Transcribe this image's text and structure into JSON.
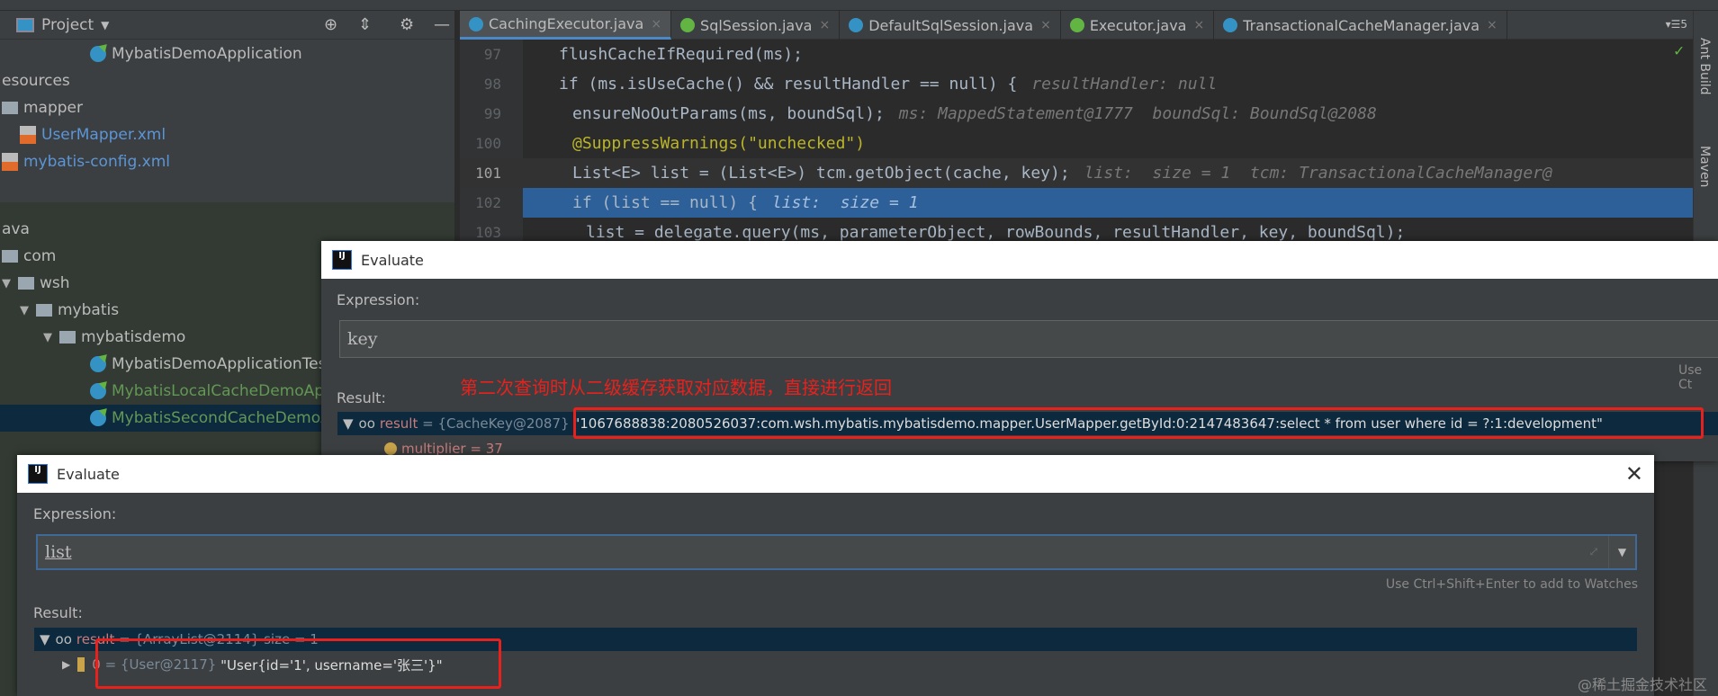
{
  "project_panel": {
    "title": "Project",
    "tree": [
      {
        "label": "MybatisDemoApplication",
        "icon": "spring-class-icon"
      },
      {
        "label": "esources",
        "icon": ""
      },
      {
        "label": "mapper",
        "icon": "folder-icon"
      },
      {
        "label": "UserMapper.xml",
        "icon": "xml-file-icon"
      },
      {
        "label": "mybatis-config.xml",
        "icon": "xml-file-icon"
      },
      {
        "label": "ava",
        "icon": ""
      },
      {
        "label": "com",
        "icon": "folder-icon"
      },
      {
        "label": "wsh",
        "icon": "package-icon"
      },
      {
        "label": "mybatis",
        "icon": "package-icon"
      },
      {
        "label": "mybatisdemo",
        "icon": "package-icon"
      },
      {
        "label": "MybatisDemoApplicationTes",
        "icon": "class-icon"
      },
      {
        "label": "MybatisLocalCacheDemoAp",
        "icon": "class-icon"
      },
      {
        "label": "MybatisSecondCacheDemoA",
        "icon": "class-icon"
      }
    ]
  },
  "tabs": [
    "CachingExecutor.java",
    "SqlSession.java",
    "DefaultSqlSession.java",
    "Executor.java",
    "TransactionalCacheManager.java"
  ],
  "tab_overflow": "5",
  "code_lines": [
    {
      "n": "97",
      "code": "flushCacheIfRequired(ms);",
      "hint": ""
    },
    {
      "n": "98",
      "code": "if (ms.isUseCache() && resultHandler == null) {",
      "hint": "resultHandler: null"
    },
    {
      "n": "99",
      "code": "ensureNoOutParams(ms, boundSql);",
      "hint": "ms: MappedStatement@1777  boundSql: BoundSql@2088"
    },
    {
      "n": "100",
      "code": "@SuppressWarnings(\"unchecked\")",
      "hint": ""
    },
    {
      "n": "101",
      "code": "List<E> list = (List<E>) tcm.getObject(cache, key);",
      "hint": "list:  size = 1  tcm: TransactionalCacheManager@"
    },
    {
      "n": "102",
      "code": "if (list == null) {",
      "hint": "list:  size = 1"
    },
    {
      "n": "103",
      "code": "list = delegate.query(ms, parameterObject, rowBounds, resultHandler, key, boundSql);",
      "hint": ""
    }
  ],
  "right_tools": [
    "Ant Build",
    "Maven"
  ],
  "eval1": {
    "title": "Evaluate",
    "expression_label": "Expression:",
    "expression": "key",
    "hint": "Use Ct",
    "result_label": "Result:",
    "result_name": "result",
    "result_type": "= {CacheKey@2087}",
    "result_value": "\"1067688838:2080526037:com.wsh.mybatis.mybatisdemo.mapper.UserMapper.getById:0:2147483647:select * from user where id = ?:1:development\"",
    "child": "multiplier = 37"
  },
  "annotation": "第二次查询时从二级缓存获取对应数据，直接进行返回",
  "eval2": {
    "title": "Evaluate",
    "expression_label": "Expression:",
    "expression": "list",
    "hint": "Use Ctrl+Shift+Enter to add to Watches",
    "result_label": "Result:",
    "result_name": "result",
    "result_type": "= {ArrayList@2114}  size = 1",
    "child_index": "0",
    "child_type": "= {User@2117}",
    "child_value": "\"User{id='1', username='张三'}\""
  },
  "watermark": "@稀土掘金技术社区"
}
